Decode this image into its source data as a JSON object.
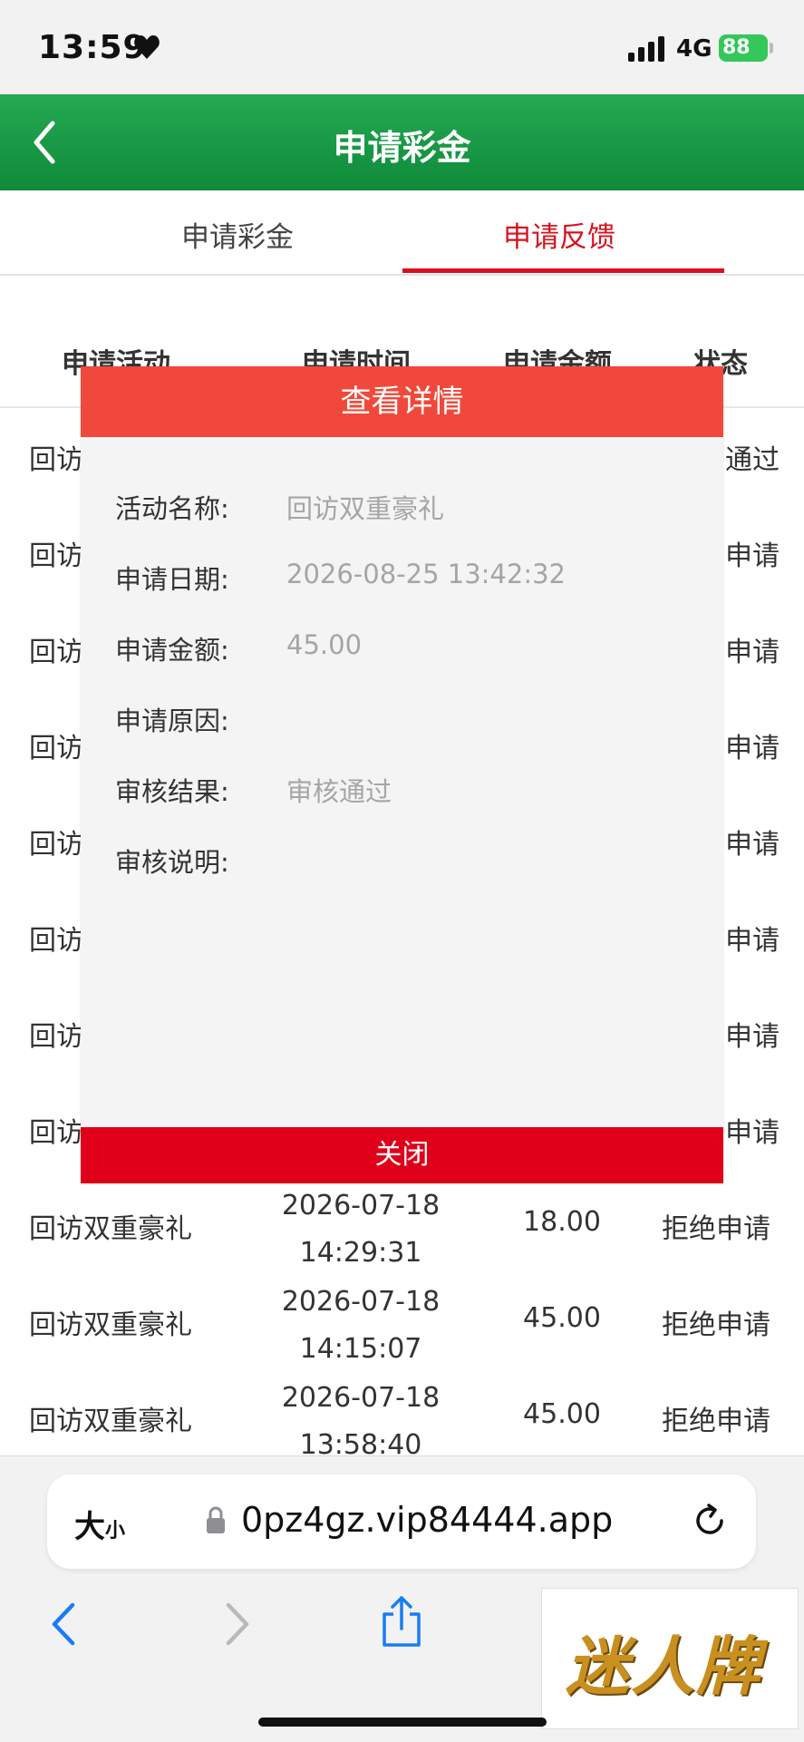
{
  "status_bar": {
    "time": "13:59",
    "network": "4G",
    "battery": "88"
  },
  "header": {
    "title": "申请彩金",
    "back_icon": "chevron-left-icon"
  },
  "tabs": [
    {
      "label": "申请彩金",
      "active": false
    },
    {
      "label": "申请反馈",
      "active": true
    }
  ],
  "table": {
    "columns": [
      "申请活动",
      "申请时间",
      "申请金额",
      "状态"
    ],
    "rows": [
      {
        "activity": "回访",
        "time_date": "",
        "time_clock": "",
        "amount": "",
        "status": "通过"
      },
      {
        "activity": "回访",
        "time_date": "",
        "time_clock": "",
        "amount": "",
        "status": "申请"
      },
      {
        "activity": "回访",
        "time_date": "",
        "time_clock": "",
        "amount": "",
        "status": "申请"
      },
      {
        "activity": "回访",
        "time_date": "",
        "time_clock": "",
        "amount": "",
        "status": "申请"
      },
      {
        "activity": "回访",
        "time_date": "",
        "time_clock": "",
        "amount": "",
        "status": "申请"
      },
      {
        "activity": "回访",
        "time_date": "",
        "time_clock": "",
        "amount": "",
        "status": "申请"
      },
      {
        "activity": "回访",
        "time_date": "",
        "time_clock": "",
        "amount": "",
        "status": "申请"
      },
      {
        "activity": "回访",
        "time_date": "",
        "time_clock": "",
        "amount": "",
        "status": "申请"
      },
      {
        "activity": "回访双重豪礼",
        "time_date": "2026-07-18",
        "time_clock": "14:29:31",
        "amount": "18.00",
        "status": "拒绝申请"
      },
      {
        "activity": "回访双重豪礼",
        "time_date": "2026-07-18",
        "time_clock": "14:15:07",
        "amount": "45.00",
        "status": "拒绝申请"
      },
      {
        "activity": "回访双重豪礼",
        "time_date": "2026-07-18",
        "time_clock": "13:58:40",
        "amount": "45.00",
        "status": "拒绝申请"
      }
    ]
  },
  "modal": {
    "title": "查看详情",
    "fields": [
      {
        "label": "活动名称:",
        "value": "回访双重豪礼"
      },
      {
        "label": "申请日期:",
        "value": "2026-08-25 13:42:32"
      },
      {
        "label": "申请金额:",
        "value": "45.00"
      },
      {
        "label": "申请原因:",
        "value": ""
      },
      {
        "label": "审核结果:",
        "value": "审核通过"
      },
      {
        "label": "审核说明:",
        "value": ""
      }
    ],
    "close_label": "关闭"
  },
  "browser": {
    "text_size_big": "大",
    "text_size_small": "小",
    "url": "0pz4gz.vip84444.app"
  },
  "watermark": {
    "text": "迷人牌"
  },
  "colors": {
    "header_green": "#1a9a47",
    "accent_red": "#d9111d",
    "modal_header": "#f0493b",
    "close_button": "#e0001a"
  }
}
